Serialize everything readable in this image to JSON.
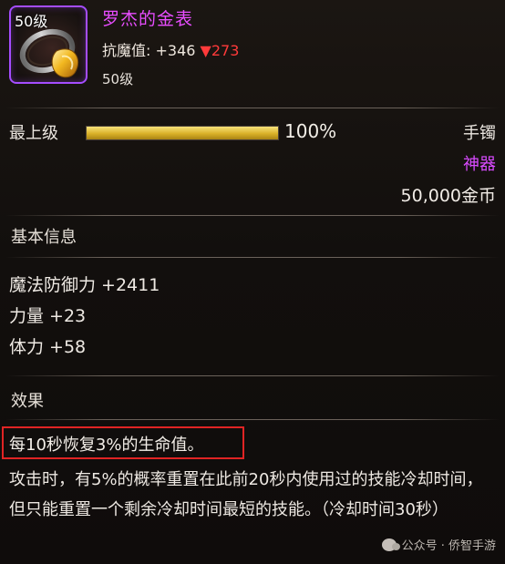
{
  "item": {
    "badge_level": "50级",
    "name": "罗杰的金表",
    "stat_label": "抗魔值: ",
    "stat_up": "+346",
    "stat_down": "▼273",
    "level_text": "50级"
  },
  "upgrade": {
    "label": "最上级",
    "progress_fraction": 1.0,
    "percent_text": "100%",
    "slot": "手镯",
    "rarity": "神器",
    "price": "50,000金币",
    "colors": {
      "rarity": "#d94bff",
      "title": "#e84dff",
      "decrease": "#ff3a3a",
      "highlight_border": "#e02424"
    }
  },
  "basic_info": {
    "heading": "基本信息",
    "attributes": [
      "魔法防御力 +2411",
      "力量 +23",
      "体力 +58"
    ]
  },
  "effects": {
    "heading": "效果",
    "highlighted": "每10秒恢复3%的生命值。",
    "description": "攻击时，有5%的概率重置在此前20秒内使用过的技能冷却时间，但只能重置一个剩余冷却时间最短的技能。（冷却时间30秒）"
  },
  "watermark": {
    "text": "公众号 · 侨智手游",
    "icon": "wechat-icon"
  }
}
